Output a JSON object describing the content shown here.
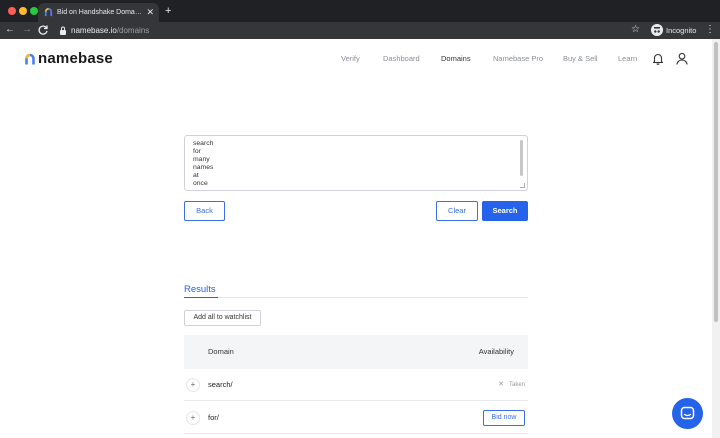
{
  "browser": {
    "tab_title": "Bid on Handshake Domains | N",
    "tab_close": "✕",
    "new_tab": "+",
    "url_host": "namebase.io",
    "url_path": "/domains",
    "incognito_label": "Incognito"
  },
  "header": {
    "logo_text": "namebase",
    "nav": [
      {
        "label": "Verify"
      },
      {
        "label": "Dashboard"
      },
      {
        "label": "Domains"
      },
      {
        "label": "Namebase Pro"
      },
      {
        "label": "Buy & Sell"
      },
      {
        "label": "Learn"
      }
    ]
  },
  "search": {
    "lines": [
      "search",
      "for",
      "many",
      "names",
      "at",
      "once"
    ],
    "back_label": "Back",
    "clear_label": "Clear",
    "search_label": "Search"
  },
  "results": {
    "title": "Results",
    "add_all_label": "Add all to watchlist",
    "columns": {
      "domain": "Domain",
      "availability": "Availability"
    },
    "rows": [
      {
        "name": "search/",
        "status": "Taken",
        "status_mark": "✕"
      },
      {
        "name": "for/",
        "action": "Bid now"
      }
    ]
  },
  "icons": {
    "bell": "bell-icon",
    "user": "user-icon",
    "chat": "chat-icon"
  },
  "colors": {
    "accent": "#2563eb"
  }
}
